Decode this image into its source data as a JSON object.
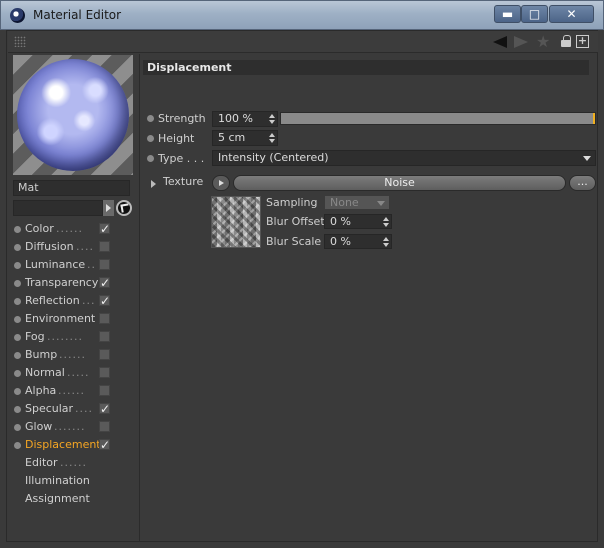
{
  "window": {
    "title": "Material Editor",
    "min_label": "▬",
    "max_label": "□",
    "close_label": "✕"
  },
  "material": {
    "name": "Mat"
  },
  "channels": [
    {
      "label": "Color",
      "dots": "......",
      "checked": true
    },
    {
      "label": "Diffusion",
      "dots": "....",
      "checked": false
    },
    {
      "label": "Luminance",
      "dots": "..",
      "checked": false
    },
    {
      "label": "Transparency",
      "dots": "",
      "checked": true
    },
    {
      "label": "Reflection",
      "dots": "...",
      "checked": true
    },
    {
      "label": "Environment",
      "dots": "",
      "checked": false
    },
    {
      "label": "Fog",
      "dots": "........",
      "checked": false
    },
    {
      "label": "Bump",
      "dots": "......",
      "checked": false
    },
    {
      "label": "Normal",
      "dots": ".....",
      "checked": false
    },
    {
      "label": "Alpha",
      "dots": "......",
      "checked": false
    },
    {
      "label": "Specular",
      "dots": "....",
      "checked": true
    },
    {
      "label": "Glow",
      "dots": ".......",
      "checked": false
    },
    {
      "label": "Displacement",
      "dots": "",
      "checked": true,
      "active": true
    }
  ],
  "extra_items": [
    {
      "label": "Editor",
      "dots": "......"
    },
    {
      "label": "Illumination",
      "dots": ""
    },
    {
      "label": "Assignment",
      "dots": ""
    }
  ],
  "displacement": {
    "section_title": "Displacement",
    "strength_label": "Strength",
    "strength_value": "100 %",
    "strength_fraction": 1.0,
    "height_label": "Height",
    "height_value": "5 cm",
    "type_label": "Type . . .",
    "type_value": "Intensity (Centered)",
    "texture_label": "Texture",
    "texture_button": "Noise",
    "texture_more": "...",
    "sampling_label": "Sampling",
    "sampling_value": "None",
    "blur_offset_label": "Blur Offset",
    "blur_offset_value": "0 %",
    "blur_scale_label": "Blur Scale",
    "blur_scale_value": "0 %"
  },
  "colors": {
    "active_channel": "#f5a623",
    "slider_end": "#f0b020"
  }
}
